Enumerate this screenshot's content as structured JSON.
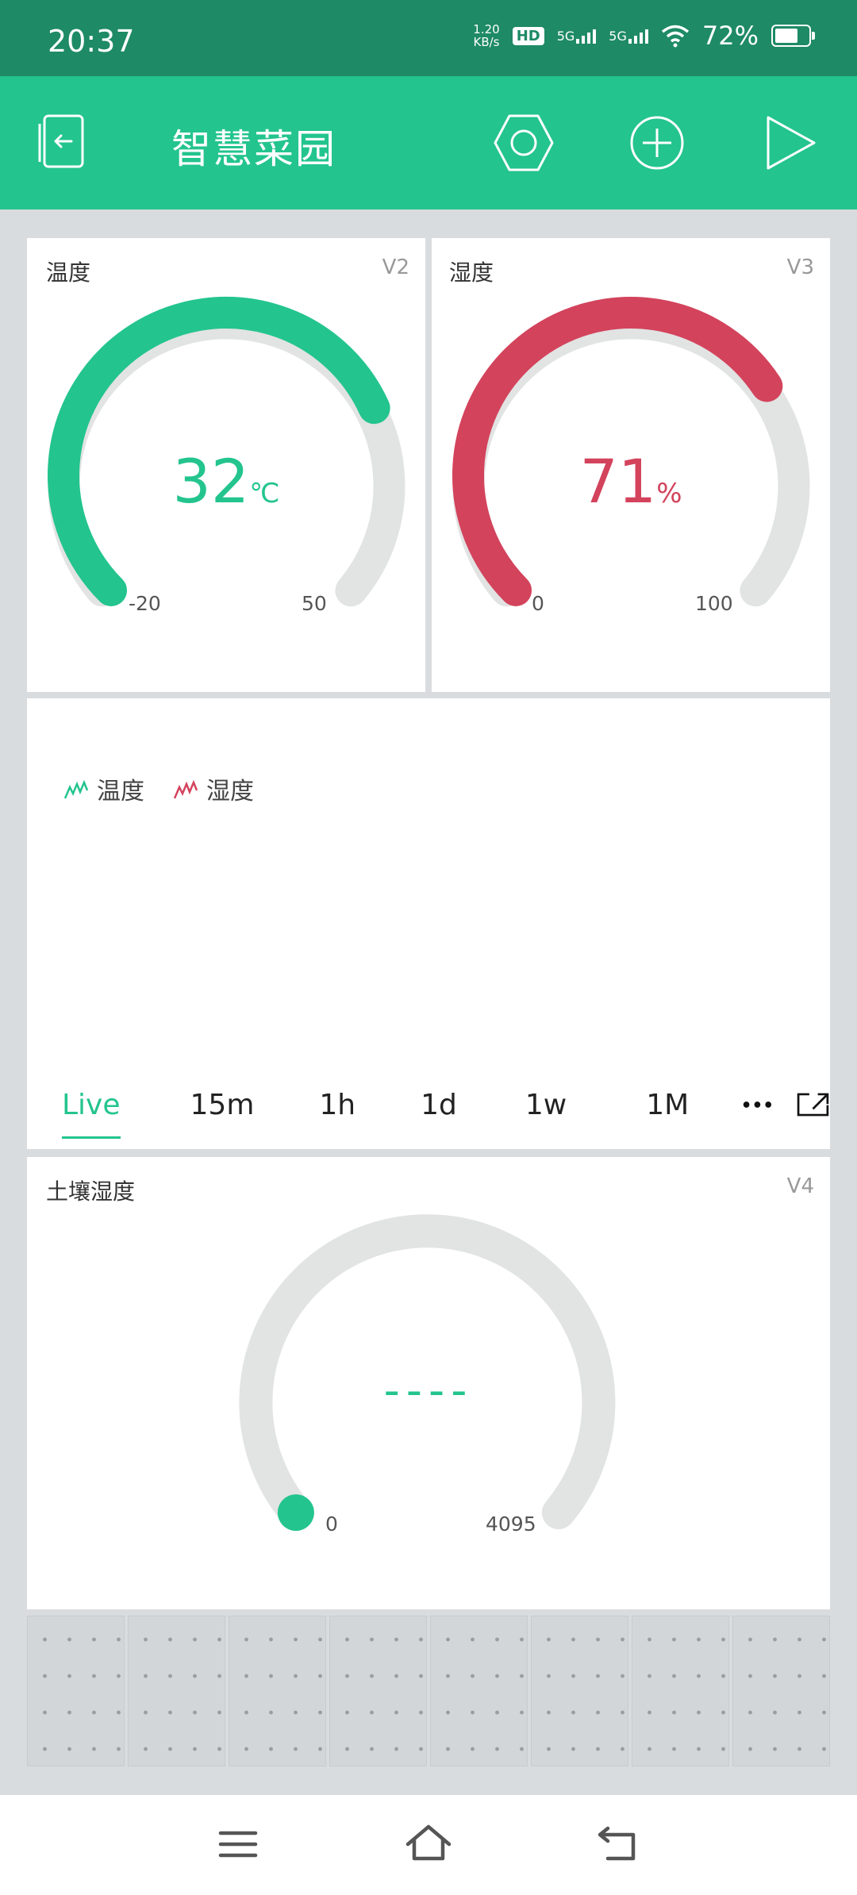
{
  "status_bar": {
    "time": "20:37",
    "net_speed_value": "1.20",
    "net_speed_unit": "KB/s",
    "hd": "HD",
    "sim1": "5G",
    "sim2": "5G",
    "battery_percent": "72%"
  },
  "app_bar": {
    "title": "智慧菜园",
    "icons": [
      "exit-icon",
      "settings-icon",
      "add-icon",
      "play-icon"
    ]
  },
  "widgets": {
    "temp_gauge": {
      "label": "温度",
      "pin": "V2",
      "value": "32",
      "unit": "℃",
      "min": "-20",
      "max": "50",
      "color": "#23c48e"
    },
    "humidity_gauge": {
      "label": "湿度",
      "pin": "V3",
      "value": "71",
      "unit": "%",
      "min": "0",
      "max": "100",
      "color": "#d3435c"
    },
    "chart": {
      "legend": [
        {
          "name": "温度",
          "color": "#23c48e"
        },
        {
          "name": "湿度",
          "color": "#d3435c"
        }
      ],
      "tabs": [
        "Live",
        "15m",
        "1h",
        "1d",
        "1w",
        "1M"
      ],
      "active_tab": "Live",
      "more_icon": "more-icon",
      "expand_icon": "expand-icon"
    },
    "soil_gauge": {
      "label": "土壤湿度",
      "pin": "V4",
      "value": "----",
      "min": "0",
      "max": "4095",
      "color": "#23c48e"
    }
  },
  "nav_bar": {
    "icons": [
      "menu-icon",
      "home-icon",
      "back-icon"
    ]
  },
  "colors": {
    "accent": "#23c48e",
    "status_bar": "#1e8a66",
    "humidity": "#d3435c",
    "track": "#e2e3e3"
  }
}
